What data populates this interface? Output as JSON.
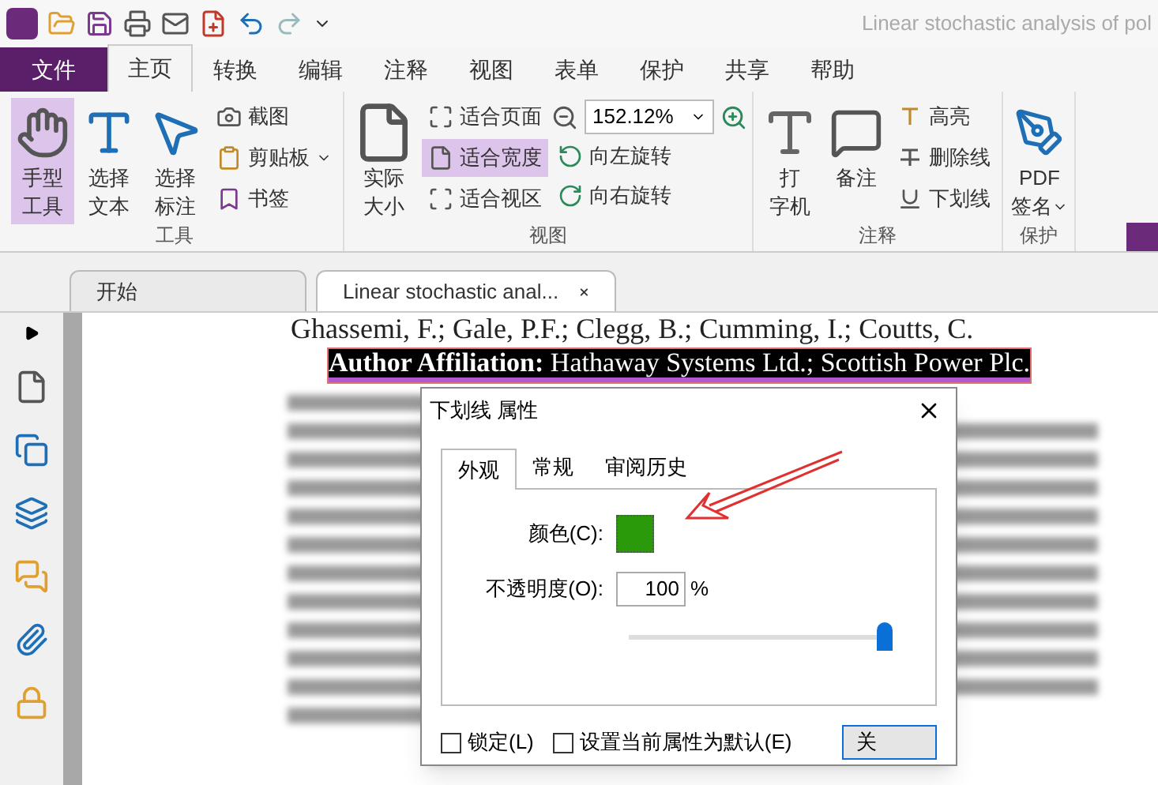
{
  "title_bar": {
    "title": "Linear stochastic analysis of pol"
  },
  "menu_tabs": [
    {
      "label": "文件",
      "kind": "file",
      "selected": false
    },
    {
      "label": "主页",
      "kind": "tab",
      "selected": true
    },
    {
      "label": "转换",
      "kind": "tab",
      "selected": false
    },
    {
      "label": "编辑",
      "kind": "tab",
      "selected": false
    },
    {
      "label": "注释",
      "kind": "tab",
      "selected": false
    },
    {
      "label": "视图",
      "kind": "tab",
      "selected": false
    },
    {
      "label": "表单",
      "kind": "tab",
      "selected": false
    },
    {
      "label": "保护",
      "kind": "tab",
      "selected": false
    },
    {
      "label": "共享",
      "kind": "tab",
      "selected": false
    },
    {
      "label": "帮助",
      "kind": "tab",
      "selected": false
    }
  ],
  "ribbon": {
    "groups": [
      {
        "label": "工具",
        "large": [
          {
            "lines": [
              "手型",
              "工具"
            ],
            "selected": true
          },
          {
            "lines": [
              "选择",
              "文本"
            ],
            "selected": false
          },
          {
            "lines": [
              "选择",
              "标注"
            ],
            "selected": false
          }
        ],
        "small": [
          {
            "label": "截图"
          },
          {
            "label": "剪贴板",
            "dropdown": true
          },
          {
            "label": "书签"
          }
        ]
      },
      {
        "label": "视图",
        "large": [
          {
            "lines": [
              "实际",
              "大小"
            ],
            "selected": false
          }
        ],
        "small": [
          {
            "label": "适合页面",
            "selected": false
          },
          {
            "label": "适合宽度",
            "selected": true
          },
          {
            "label": "适合视区",
            "selected": false
          }
        ],
        "zoom": {
          "value": "152.12%"
        },
        "rotate": [
          {
            "label": "向左旋转"
          },
          {
            "label": "向右旋转"
          }
        ]
      },
      {
        "label": "注释",
        "large": [
          {
            "lines": [
              "打",
              "字机"
            ]
          },
          {
            "lines": [
              "备注"
            ]
          }
        ],
        "small": [
          {
            "label": "高亮"
          },
          {
            "label": "删除线"
          },
          {
            "label": "下划线"
          }
        ]
      },
      {
        "label": "保护",
        "large": [
          {
            "lines": [
              "PDF",
              "签名"
            ],
            "dropdown": true
          }
        ]
      }
    ]
  },
  "doc_tabs": [
    {
      "label": "开始",
      "selected": false,
      "closable": false
    },
    {
      "label": "Linear stochastic anal...",
      "selected": true,
      "closable": true
    }
  ],
  "document": {
    "authors": "Ghassemi, F.; Gale, P.F.; Clegg, B.; Cumming, I.; Coutts, C.",
    "affiliation": "**Author Affiliation:** Hathaway Systems Ltd.; Scottish Power Plc.",
    "affiliation_selected": true
  },
  "dialog": {
    "title": "下划线 属性",
    "tabs": [
      {
        "label": "外观",
        "selected": true
      },
      {
        "label": "常规",
        "selected": false
      },
      {
        "label": "审阅历史",
        "selected": false
      }
    ],
    "color_label": "颜色(C):",
    "color": "#2a9a0a",
    "opacity_label": "不透明度(O):",
    "opacity_value": "100",
    "opacity_unit": "%",
    "opacity_slider": {
      "level": 0.98
    },
    "checkboxes": [
      {
        "label": "锁定(L)",
        "checked": false
      },
      {
        "label": "设置当前属性为默认(E)",
        "checked": false
      }
    ],
    "button": "关"
  }
}
